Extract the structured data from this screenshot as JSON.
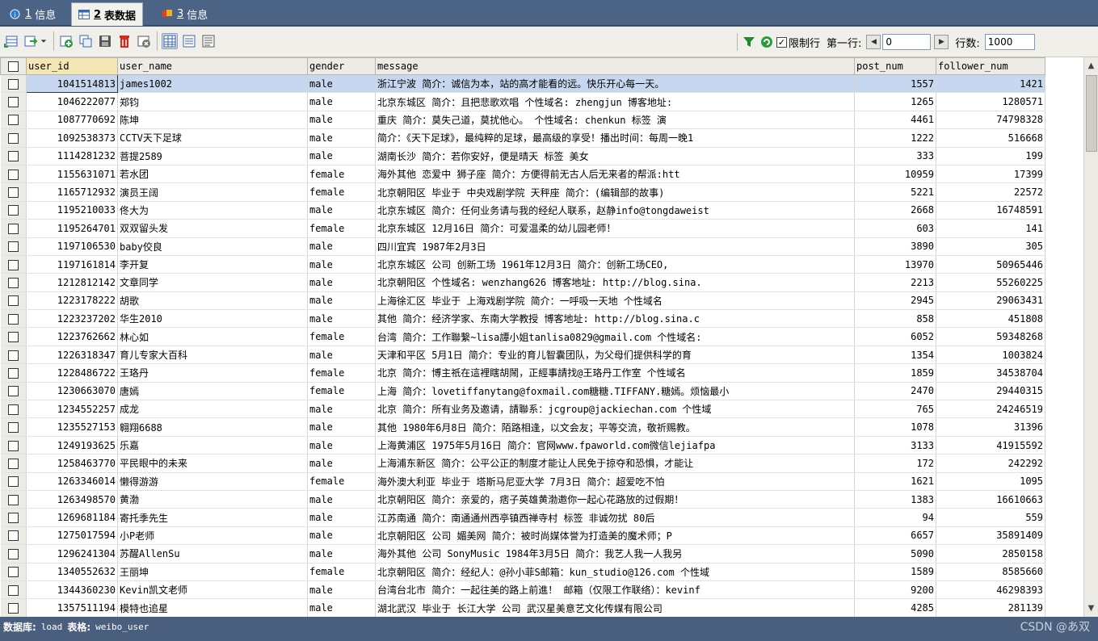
{
  "tabs": [
    {
      "num": "1",
      "label": "信息"
    },
    {
      "num": "2",
      "label": "表数据"
    },
    {
      "num": "3",
      "label": "信息"
    }
  ],
  "toolbar": {
    "limit_rows_label": "限制行",
    "first_row_label": "第一行:",
    "first_row_value": "0",
    "rows_label": "行数:",
    "rows_value": "1000"
  },
  "columns": [
    "user_id",
    "user_name",
    "gender",
    "message",
    "post_num",
    "follower_num"
  ],
  "rows": [
    [
      "1041514813",
      "james1002",
      "male",
      "浙江宁波  简介：诚信为本，站的高才能看的远。快乐开心每一天。",
      "1557",
      "1421"
    ],
    [
      "1046222077",
      "郑钧",
      "male",
      "北京东城区  简介：且把悲歌欢唱  个性域名: zhengjun  博客地址:",
      "1265",
      "1280571"
    ],
    [
      "1087770692",
      "陈坤",
      "male",
      "重庆  简介：莫失己道，莫扰他心。  个性域名: chenkun  标签 演",
      "4461",
      "74798328"
    ],
    [
      "1092538373",
      "CCTV天下足球",
      "male",
      "简介：《天下足球》，最纯粹的足球，最高级的享受！播出时间：每周一晚1",
      "1222",
      "516668"
    ],
    [
      "1114281232",
      "菩提2589",
      "male",
      "湖南长沙  简介：若你安好，便是晴天  标签 美女",
      "333",
      "199"
    ],
    [
      "1155631071",
      "若水团",
      "female",
      "海外其他  恋爱中  狮子座  简介：方便得前无古人后无来者的帮派:htt",
      "10959",
      "17399"
    ],
    [
      "1165712932",
      "演员王阔",
      "female",
      "北京朝阳区  毕业于 中央戏剧学院  天秤座  简介：(编辑部的故事)",
      "5221",
      "22572"
    ],
    [
      "1195210033",
      "佟大为",
      "male",
      "北京东城区  简介：任何业务请与我的经纪人联系，赵静info@tongdaweist",
      "2668",
      "16748591"
    ],
    [
      "1195264701",
      "双双留头发",
      "female",
      "北京东城区  12月16日  简介：可爱温柔的幼儿园老师！",
      "603",
      "141"
    ],
    [
      "1197106530",
      "baby佼良",
      "male",
      "四川宜宾  1987年2月3日",
      "3890",
      "305"
    ],
    [
      "1197161814",
      "李开复",
      "male",
      "北京东城区  公司 创新工场  1961年12月3日  简介：创新工场CEO,",
      "13970",
      "50965446"
    ],
    [
      "1212812142",
      "文章同学",
      "male",
      "北京朝阳区  个性域名: wenzhang626  博客地址: http://blog.sina.",
      "2213",
      "55260225"
    ],
    [
      "1223178222",
      "胡歌",
      "male",
      "上海徐汇区  毕业于 上海戏剧学院  简介：一呼吸一天地  个性域名",
      "2945",
      "29063431"
    ],
    [
      "1223237202",
      "华生2010",
      "male",
      "其他  简介：经济学家、东南大学教授  博客地址: http://blog.sina.c",
      "858",
      "451808"
    ],
    [
      "1223762662",
      "林心如",
      "female",
      "台湾  简介：工作聯繫~lisa譚小姐tanlisa0829@gmail.com  个性域名:",
      "6052",
      "59348268"
    ],
    [
      "1226318347",
      "育儿专家大百科",
      "male",
      "天津和平区  5月1日  简介：专业的育儿智囊团队，为父母们提供科学的育",
      "1354",
      "1003824"
    ],
    [
      "1228486722",
      "王珞丹",
      "female",
      "北京  简介：博主祇在這裡瞎胡鬧，正經事請找@王珞丹工作室  个性域名",
      "1859",
      "34538704"
    ],
    [
      "1230663070",
      "唐嫣",
      "female",
      "上海  简介：lovetiffanytang@foxmail.com糖糖.TIFFANY.糖嫣。烦恼最小",
      "2470",
      "29440315"
    ],
    [
      "1234552257",
      "成龙",
      "male",
      "北京  简介：所有业务及邀请，請聯系：jcgroup@jackiechan.com  个性域",
      "765",
      "24246519"
    ],
    [
      "1235527153",
      "翱翔6688",
      "male",
      "其他  1980年6月8日  简介：陌路相逢，以文会友；平等交流，敬祈赐教。",
      "1078",
      "31396"
    ],
    [
      "1249193625",
      "乐嘉",
      "male",
      "上海黄浦区  1975年5月16日  简介：官网www.fpaworld.com微信lejiafpa",
      "3133",
      "41915592"
    ],
    [
      "1258463770",
      "平民眼中的未来",
      "male",
      "上海浦东新区  简介：公平公正的制度才能让人民免于掠夺和恐惧，才能让",
      "172",
      "242292"
    ],
    [
      "1263346014",
      "懒得游游",
      "female",
      "海外澳大利亚  毕业于 塔斯马尼亚大学  7月3日  简介：超爱吃不怕",
      "1621",
      "1095"
    ],
    [
      "1263498570",
      "黄渤",
      "male",
      "北京朝阳区  简介：亲爱的，痞子英雄黄渤邀你一起心花路放的过假期！",
      "1383",
      "16610663"
    ],
    [
      "1269681184",
      "寄托季先生",
      "male",
      "江苏南通  简介：南通通州西亭镇西禅寺村  标签 非诚勿扰 80后",
      "94",
      "559"
    ],
    [
      "1275017594",
      "小P老师",
      "male",
      "北京朝阳区  公司 媚美网  简介：被时尚媒体誉为打造美的魔术师；P",
      "6657",
      "35891409"
    ],
    [
      "1296241304",
      "苏醒AllenSu",
      "male",
      "海外其他  公司 SonyMusic  1984年3月5日  简介：我艺人我一人我另",
      "5090",
      "2850158"
    ],
    [
      "1340552632",
      "王丽坤",
      "female",
      "北京朝阳区  简介：经纪人：@孙小菲S邮箱：kun_studio@126.com  个性域",
      "1589",
      "8585660"
    ],
    [
      "1344360230",
      "Kevin凯文老师",
      "male",
      "台湾台北市  简介：一起往美的路上前進！ 邮箱（仅限工作联络）：kevinf",
      "9200",
      "46298393"
    ],
    [
      "1357511194",
      "模特也追星",
      "male",
      "湖北武汉  毕业于 长江大学  公司 武汉星美意艺文化传媒有限公司",
      "4285",
      "281139"
    ]
  ],
  "status": {
    "db_label": "数据库:",
    "db_value": "load",
    "table_label": "表格:",
    "table_value": "weibo_user",
    "watermark": "CSDN @あ双"
  },
  "colors": {
    "accent": "#4b6384",
    "selected_row": "#c7d7ef"
  }
}
